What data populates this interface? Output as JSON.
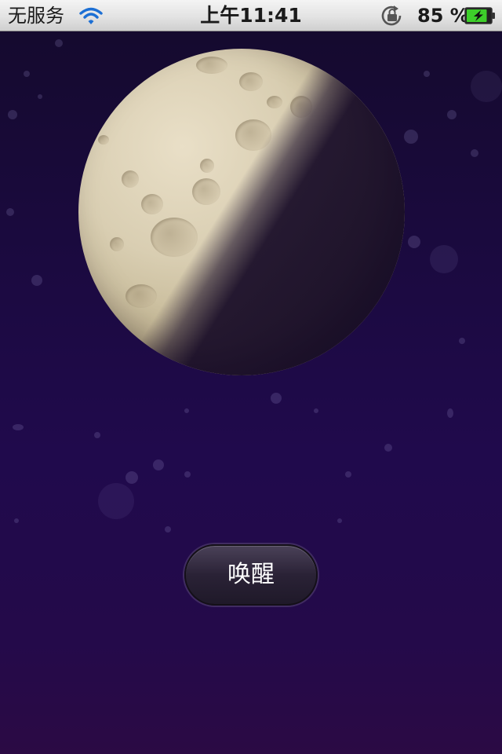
{
  "status_bar": {
    "carrier": "无服务",
    "time": "上午11:41",
    "battery_percent": "85 %",
    "wifi_icon": "wifi-icon",
    "rotation_lock_icon": "rotation-lock-icon",
    "battery_icon": "battery-charging-icon",
    "battery_level": 0.85
  },
  "main": {
    "moon_icon": "moon-icon",
    "wake_button_label": "唤醒"
  },
  "colors": {
    "background_top": "#140a2c",
    "background_bottom": "#2b0a44",
    "battery_fill": "#3dcf2a",
    "wifi_blue": "#1c6fd4"
  }
}
